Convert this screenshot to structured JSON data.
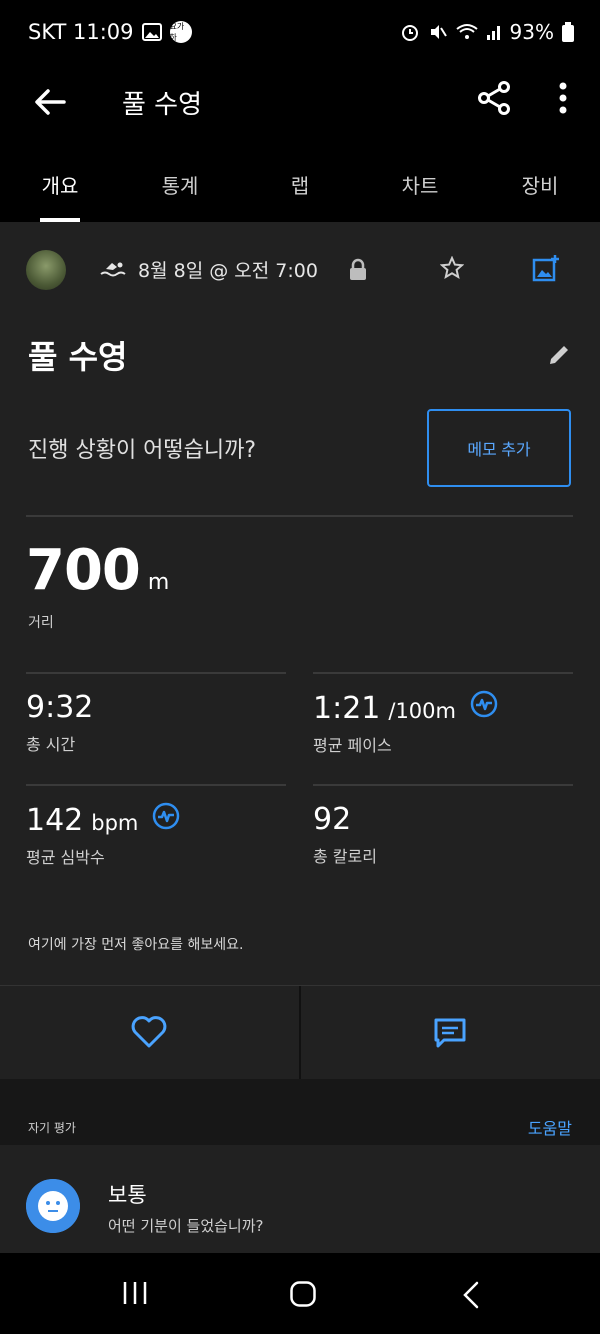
{
  "status_bar": {
    "carrier_time": "SKT 11:09",
    "badge_text": "요가하",
    "battery": "93%"
  },
  "app_bar": {
    "title": "풀 수영"
  },
  "tabs": [
    {
      "label": "개요"
    },
    {
      "label": "통계"
    },
    {
      "label": "랩"
    },
    {
      "label": "차트"
    },
    {
      "label": "장비"
    }
  ],
  "activity": {
    "date_time": "8월 8일 @ 오전 7:00",
    "title": "풀 수영",
    "prompt": "진행 상황이 어떻습니까?",
    "memo_button": "메모 추가"
  },
  "distance": {
    "value": "700",
    "unit": "m",
    "label": "거리"
  },
  "stats": {
    "total_time": {
      "value": "9:32",
      "label": "총 시간"
    },
    "avg_pace": {
      "value": "1:21",
      "unit": "/100m",
      "label": "평균 페이스"
    },
    "avg_hr": {
      "value": "142",
      "unit": "bpm",
      "label": "평균 심박수"
    },
    "calories": {
      "value": "92",
      "label": "총 칼로리"
    }
  },
  "kudos_prompt": "여기에 가장 먼저 좋아요를 해보세요.",
  "self_eval": {
    "section_label": "자기 평가",
    "help_link": "도움말",
    "title": "보통",
    "subtitle": "어떤 기분이 들었습니까?"
  },
  "colors": {
    "accent": "#2f8ef0",
    "card_bg": "#212121",
    "background": "#000000"
  }
}
